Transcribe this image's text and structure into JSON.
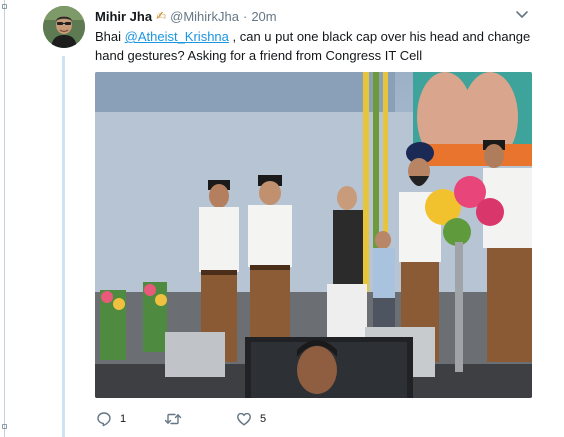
{
  "tweet": {
    "author": {
      "display_name": "Mihir Jha",
      "name_emoji": "✍",
      "handle": "@MihirkJha"
    },
    "separator": "·",
    "time": "20m",
    "text_before": "Bhai ",
    "mention": "@Atheist_Krishna",
    "text_after": " , can u put one black cap over his head and change hand gestures? Asking for a friend from Congress IT Cell",
    "actions": {
      "reply_count": "1",
      "retweet_count": "",
      "like_count": "5"
    }
  },
  "icons": {
    "menu": "chevron-down-icon",
    "reply": "reply-icon",
    "retweet": "retweet-icon",
    "like": "heart-icon"
  },
  "colors": {
    "link": "#1b95e0",
    "secondary_text": "#657786",
    "thread_line": "#cfe3f4",
    "action_icon": "#657786"
  }
}
